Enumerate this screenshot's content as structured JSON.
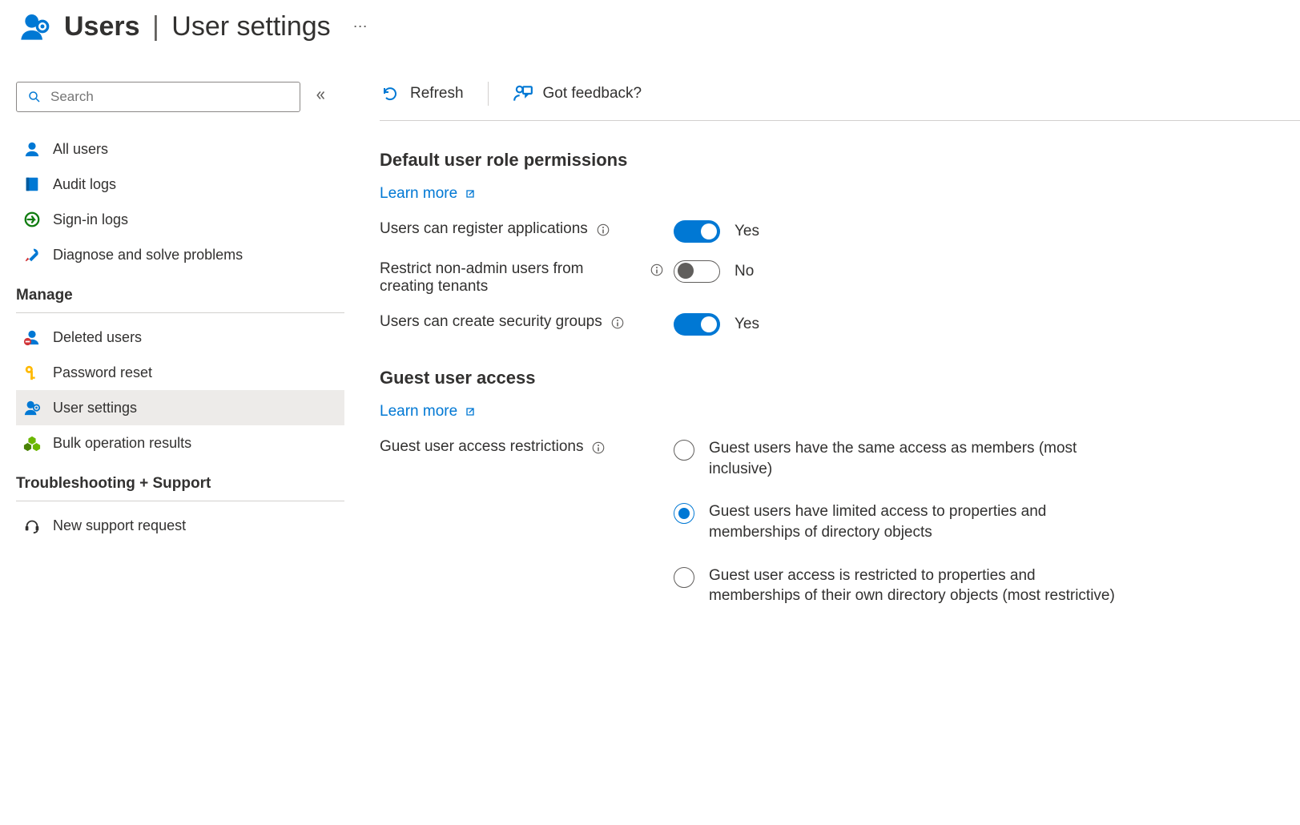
{
  "header": {
    "title_strong": "Users",
    "title_sep": "|",
    "title_sub": "User settings"
  },
  "sidebar": {
    "search_placeholder": "Search",
    "top_items": [
      {
        "label": "All users",
        "icon": "user",
        "active": false
      },
      {
        "label": "Audit logs",
        "icon": "book",
        "active": false
      },
      {
        "label": "Sign-in logs",
        "icon": "signin",
        "active": false
      },
      {
        "label": "Diagnose and solve problems",
        "icon": "wrench",
        "active": false
      }
    ],
    "sections": [
      {
        "heading": "Manage",
        "items": [
          {
            "label": "Deleted users",
            "icon": "user-del",
            "active": false
          },
          {
            "label": "Password reset",
            "icon": "key",
            "active": false
          },
          {
            "label": "User settings",
            "icon": "user-gear",
            "active": true
          },
          {
            "label": "Bulk operation results",
            "icon": "cubes",
            "active": false
          }
        ]
      },
      {
        "heading": "Troubleshooting + Support",
        "items": [
          {
            "label": "New support request",
            "icon": "headset",
            "active": false
          }
        ]
      }
    ]
  },
  "toolbar": {
    "refresh": "Refresh",
    "feedback": "Got feedback?"
  },
  "sections": {
    "defaultperms": {
      "heading": "Default user role permissions",
      "learn_more": "Learn more",
      "rows": [
        {
          "label": "Users can register applications",
          "on": true,
          "value": "Yes"
        },
        {
          "label": "Restrict non-admin users from creating tenants",
          "on": false,
          "value": "No"
        },
        {
          "label": "Users can create security groups",
          "on": true,
          "value": "Yes"
        }
      ]
    },
    "guest": {
      "heading": "Guest user access",
      "learn_more": "Learn more",
      "row_label": "Guest user access restrictions",
      "options": [
        {
          "label": "Guest users have the same access as members (most inclusive)",
          "selected": false
        },
        {
          "label": "Guest users have limited access to properties and memberships of directory objects",
          "selected": true
        },
        {
          "label": "Guest user access is restricted to properties and memberships of their own directory objects (most restrictive)",
          "selected": false
        }
      ]
    }
  }
}
